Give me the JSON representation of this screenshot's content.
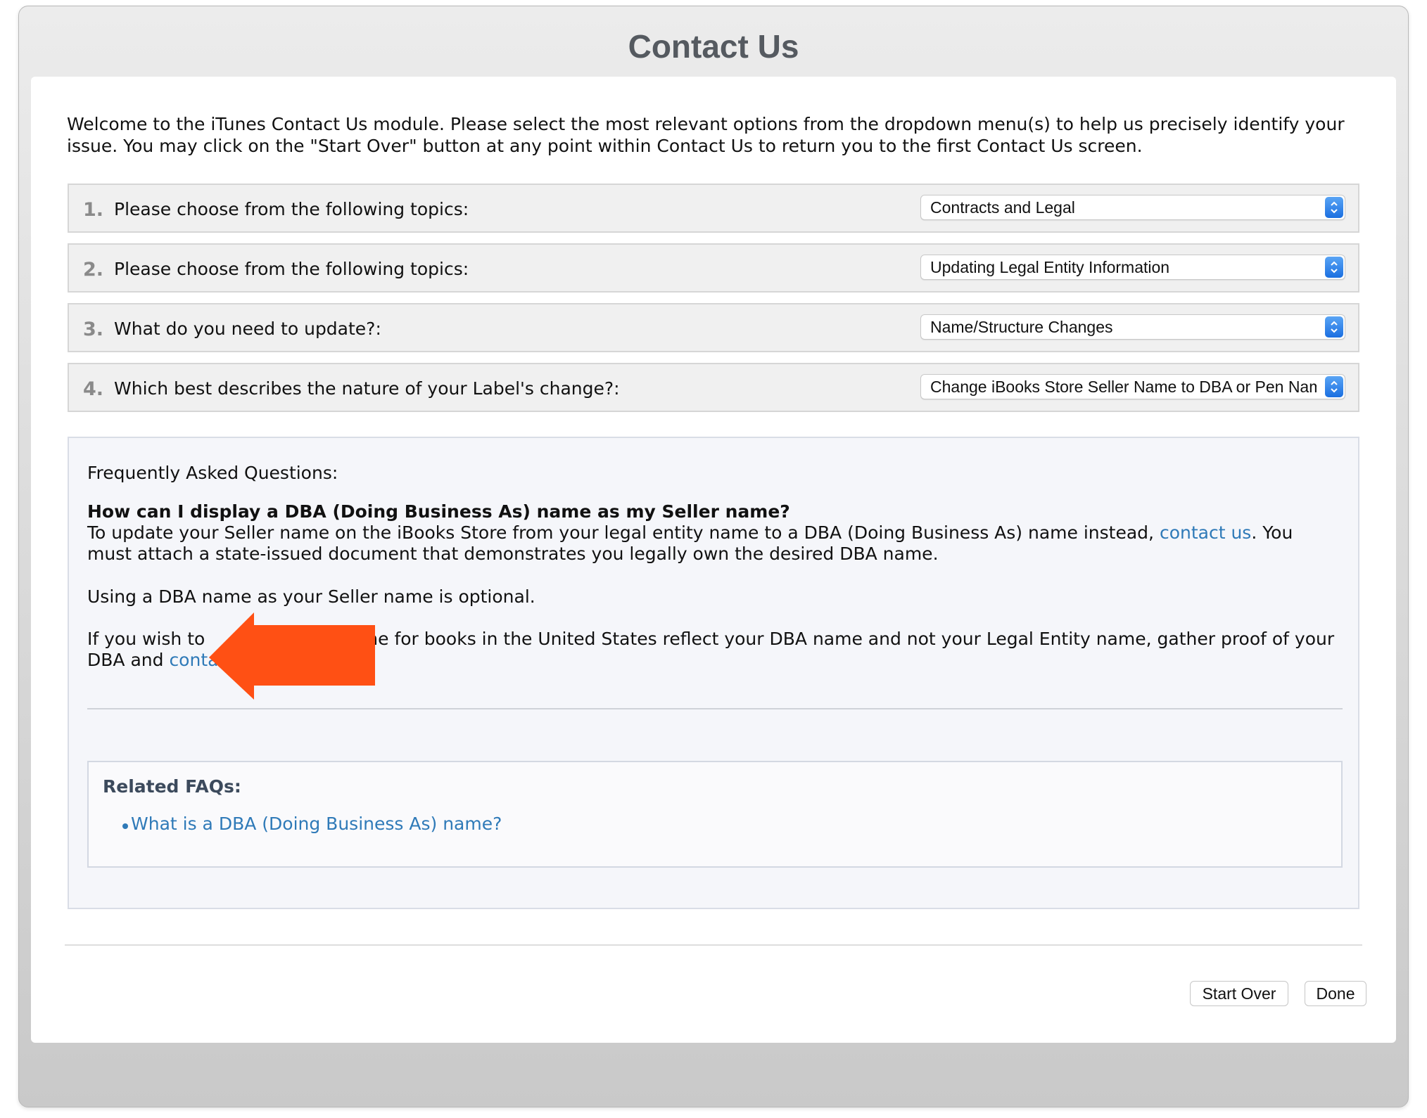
{
  "window": {
    "title": "Contact Us"
  },
  "intro": "Welcome to the iTunes Contact Us module. Please select the most relevant options from the dropdown menu(s) to help us precisely identify your issue. You may click on the \"Start Over\" button at any point within Contact Us to return you to the first Contact Us screen.",
  "questions": [
    {
      "number": "1.",
      "label": "Please choose from the following topics:",
      "selected": "Contracts and Legal"
    },
    {
      "number": "2.",
      "label": "Please choose from the following topics:",
      "selected": "Updating Legal Entity Information"
    },
    {
      "number": "3.",
      "label": "What do you need to update?:",
      "selected": "Name/Structure Changes"
    },
    {
      "number": "4.",
      "label": "Which best describes the nature of your Label's change?:",
      "selected": "Change iBooks Store Seller Name to DBA or Pen Name"
    }
  ],
  "faq": {
    "heading": "Frequently Asked Questions:",
    "question": "How can I display a DBA (Doing Business As) name as my Seller name?",
    "p1_before": "To update your Seller name on the iBooks Store from your legal entity name to a DBA (Doing Business As) name instead, ",
    "p1_link": "contact us",
    "p1_after": ". You must attach a state-issued document that demonstrates you legally own the desired DBA name.",
    "p2": "Using a DBA name as your Seller name is optional.",
    "p3_before": "If you wish to ",
    "p3_after": "ne for books in the United States reflect your DBA name and not your Legal Entity name, gather proof of your DBA and ",
    "p3_link": "contact us",
    "p3_end": "."
  },
  "related": {
    "title": "Related FAQs:",
    "items": [
      "What is a DBA (Doing Business As) name?"
    ]
  },
  "buttons": {
    "start_over": "Start Over",
    "done": "Done"
  },
  "colors": {
    "annotation_arrow": "#ff5014",
    "link": "#2f7ab8",
    "select_arrow": "#1b6fe0"
  },
  "annotation": {
    "type": "arrow",
    "direction": "left",
    "icon": "red-arrow-icon"
  }
}
